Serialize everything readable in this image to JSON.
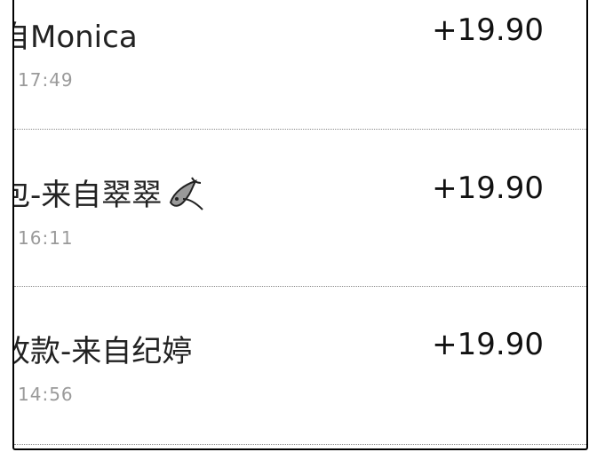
{
  "transactions": [
    {
      "title": "自Monica",
      "time": "17:49",
      "amount": "+19.90",
      "emoji": ""
    },
    {
      "title": "包-来自翠翠",
      "time": "16:11",
      "amount": "+19.90",
      "emoji": "fish-emoji"
    },
    {
      "title": "收款-来自纪婷",
      "time": "14:56",
      "amount": "+19.90",
      "emoji": ""
    }
  ]
}
